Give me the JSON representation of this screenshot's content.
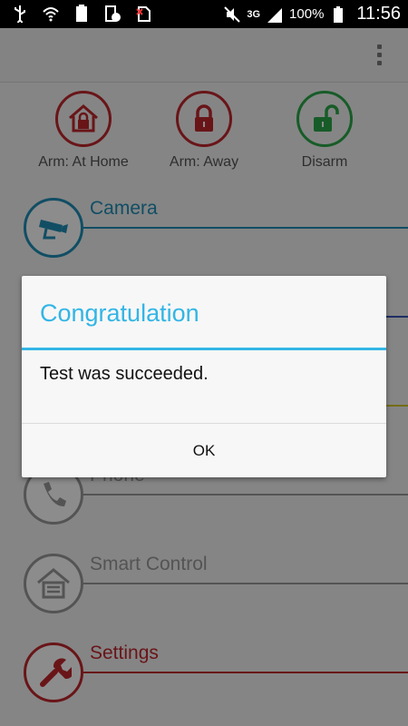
{
  "status_bar": {
    "battery_percent": "100%",
    "network": "3G",
    "time": "11:56",
    "left_icons": [
      "usb-icon",
      "wifi-icon",
      "battery-100-icon",
      "screenshot-icon",
      "no-sim-icon"
    ]
  },
  "arm_buttons": [
    {
      "label": "Arm: At Home",
      "color": "#c0272d"
    },
    {
      "label": "Arm: Away",
      "color": "#c0272d"
    },
    {
      "label": "Disarm",
      "color": "#2aa84a"
    }
  ],
  "menu": [
    {
      "label": "Camera",
      "color": "#1f8fb7"
    },
    {
      "label": "",
      "color": "#3a55b5"
    },
    {
      "label": "",
      "color": "#d6c62a"
    },
    {
      "label": "Phone",
      "color": "#8a8a8a"
    },
    {
      "label": "Smart Control",
      "color": "#8a8a8a"
    },
    {
      "label": "Settings",
      "color": "#c0272d"
    }
  ],
  "dialog": {
    "title": "Congratulation",
    "message": "Test was succeeded.",
    "ok_label": "OK",
    "accent": "#33b5e5"
  }
}
